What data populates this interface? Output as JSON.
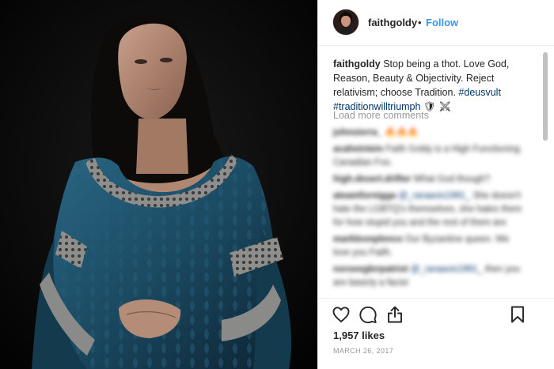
{
  "post": {
    "username": "faithgoldy",
    "follow_label": "Follow",
    "separator": "•",
    "caption": {
      "text": "Stop being a thot. Love God, Reason, Beauty & Objectivity. Reject relativism; choose Tradition.",
      "hashtag_1": "#deusvult",
      "hashtag_2": "#traditionwilltriumph",
      "emoji": "🛡 ⚔"
    },
    "load_more_label": "Load more comments",
    "comments": [
      {
        "user": "johnsierra_",
        "mention": "",
        "text": "🔥🔥🔥"
      },
      {
        "user": "acaheintein",
        "mention": "",
        "text": "Faith Goldy is a High Functioning Canadian Fox."
      },
      {
        "user": "high.desert.drifter",
        "mention": "",
        "text": "What God though?"
      },
      {
        "user": "ateamfornigga",
        "mention": "@_raraavis1991_",
        "text": "She doesn't hate the LGBTQ's themselves, she hates them for how stupid you and the rest of them are"
      },
      {
        "user": "markleonplence",
        "mention": "",
        "text": "Our Byzantine queen. We love you Faith."
      },
      {
        "user": "norseeglerpatriot",
        "mention": "@_raraavis1991_",
        "text": "then you are basicly a facist"
      }
    ],
    "likes": "1,957 likes",
    "date": "MARCH 26, 2017"
  },
  "icons": {
    "like": "heart-icon",
    "comment": "comment-icon",
    "share": "share-icon",
    "save": "bookmark-icon"
  },
  "colors": {
    "link_blue": "#3897f0",
    "hashtag_blue": "#003569",
    "text": "#262626",
    "muted": "#999999",
    "dress_teal": "#1b4a62"
  }
}
